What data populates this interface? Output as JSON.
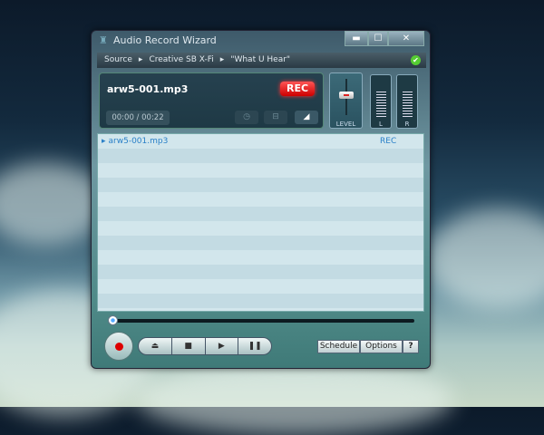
{
  "window": {
    "title": "Audio Record Wizard",
    "minimize": "▬",
    "maximize": "☐",
    "close": "✕"
  },
  "breadcrumb": [
    "Source",
    "Creative SB X-Fi",
    "\"What U Hear\""
  ],
  "breadcrumb_sep": "▸",
  "status_ok": "✔",
  "panel": {
    "filename": "arw5-001.mp3",
    "rec_label": "REC",
    "time": "00:00 / 00:22",
    "icons": [
      "◷",
      "⊟",
      "◢"
    ]
  },
  "level": {
    "label": "LEVEL"
  },
  "meters": {
    "left": "L",
    "right": "R"
  },
  "list": [
    {
      "name": "arw5-001.mp3",
      "status": "REC",
      "arrow": "▸"
    }
  ],
  "transport": {
    "eject": "⏏",
    "stop": "■",
    "play": "▶",
    "pause": "❚❚"
  },
  "buttons": {
    "schedule": "Schedule",
    "options": "Options",
    "help": "?"
  }
}
